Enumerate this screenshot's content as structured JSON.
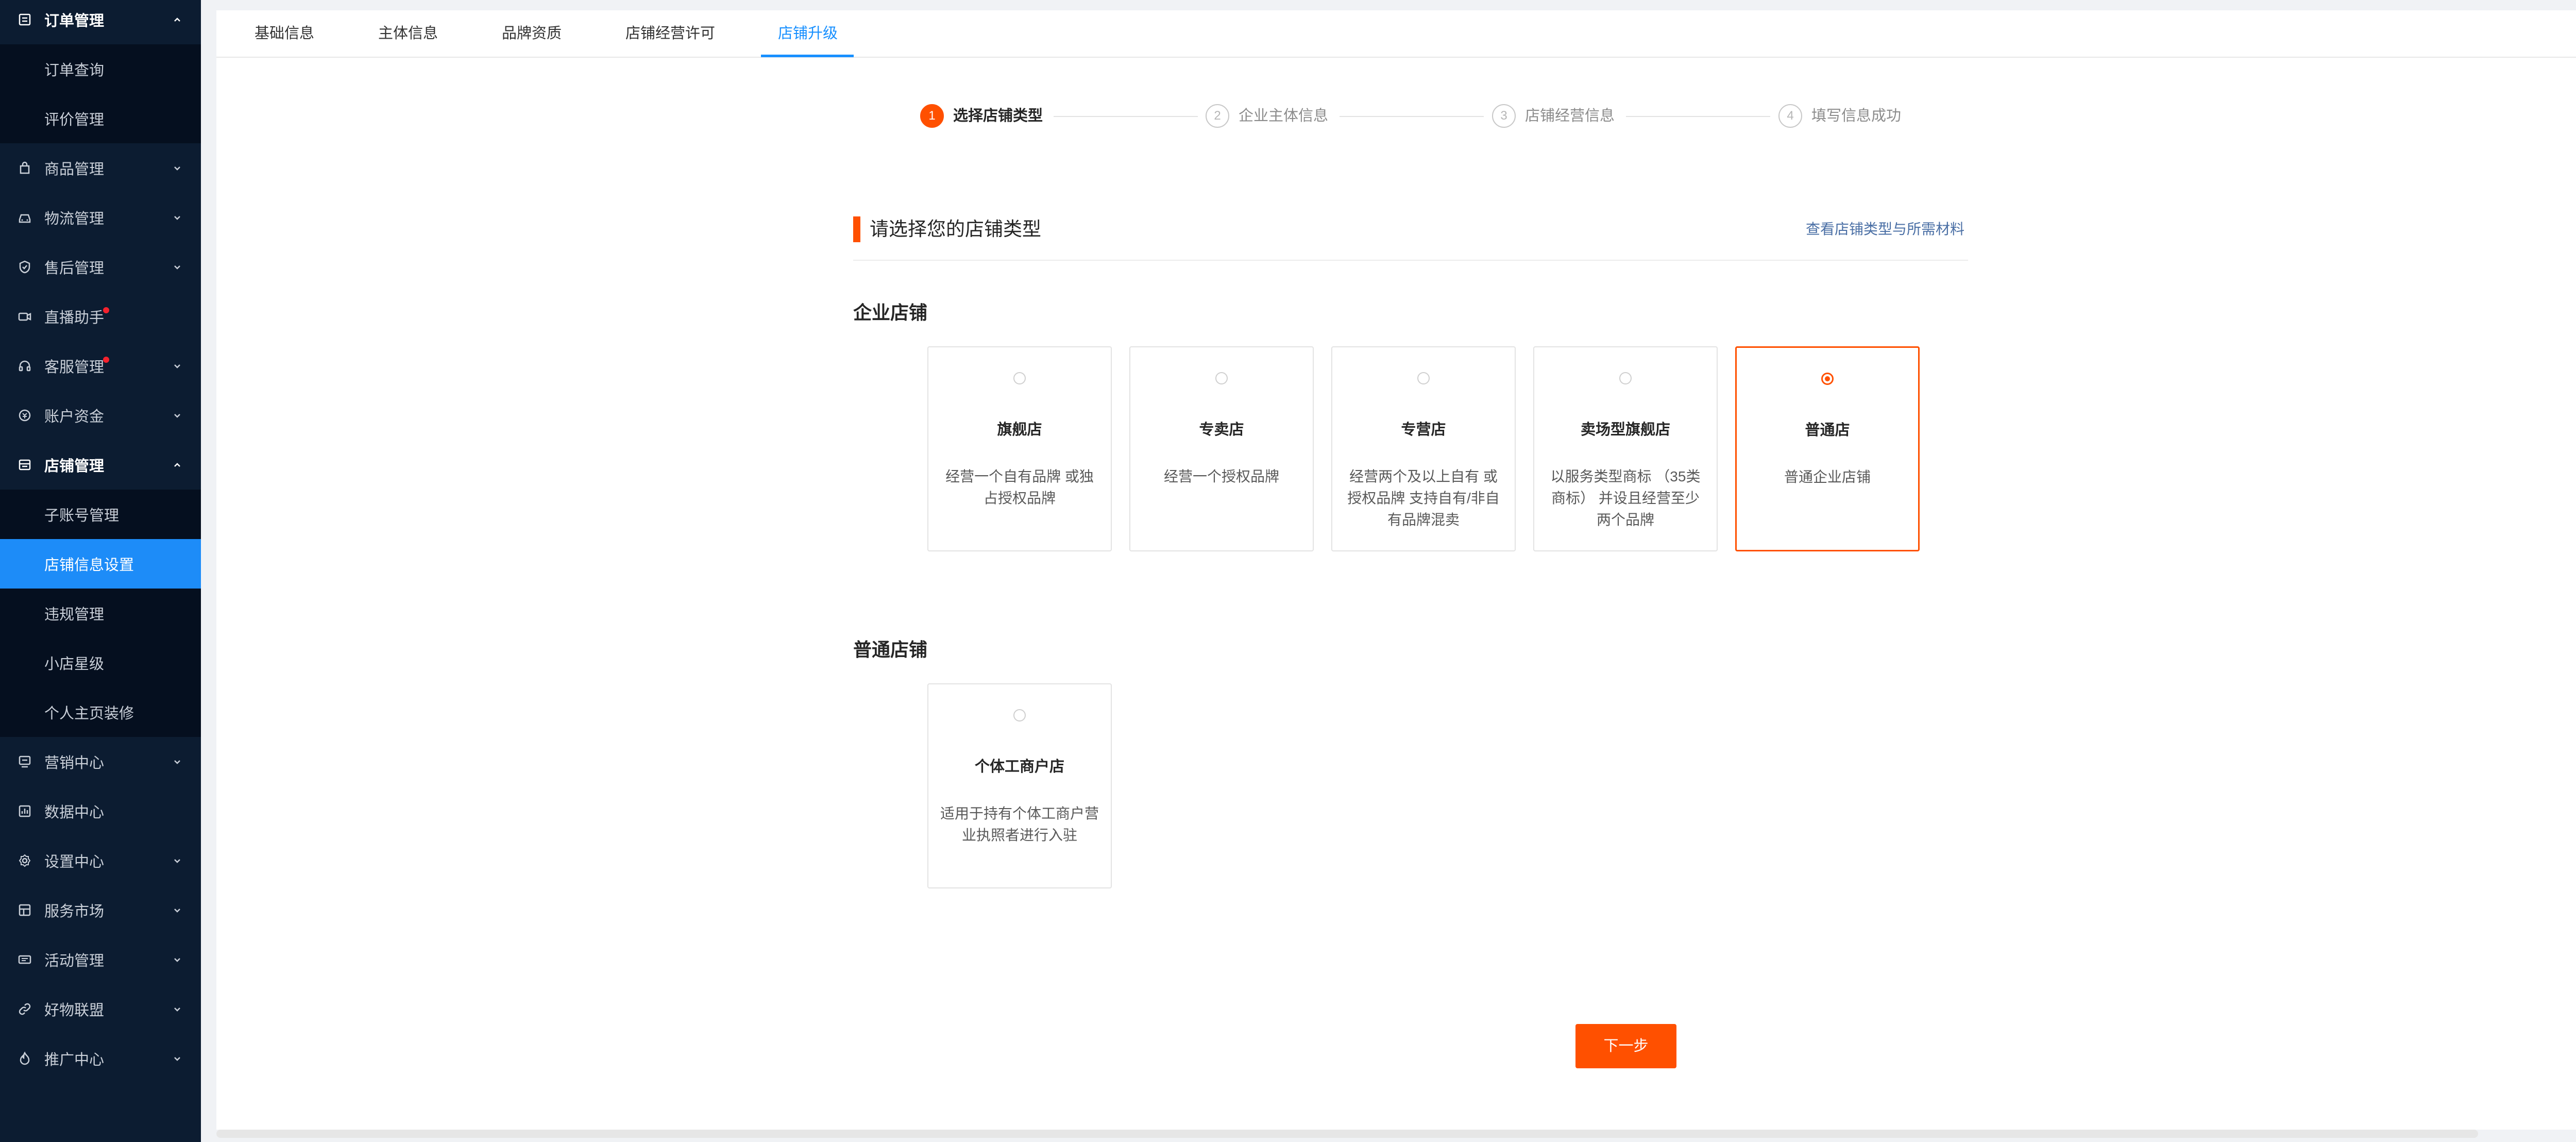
{
  "sidebar": {
    "order": {
      "label": "订单管理",
      "children": [
        "订单查询",
        "评价管理"
      ]
    },
    "goods": {
      "label": "商品管理"
    },
    "logistics": {
      "label": "物流管理"
    },
    "aftersale": {
      "label": "售后管理"
    },
    "live": {
      "label": "直播助手"
    },
    "service": {
      "label": "客服管理"
    },
    "funds": {
      "label": "账户资金"
    },
    "shop": {
      "label": "店铺管理",
      "children": [
        "子账号管理",
        "店铺信息设置",
        "违规管理",
        "小店星级",
        "个人主页装修"
      ]
    },
    "marketing": {
      "label": "营销中心"
    },
    "data": {
      "label": "数据中心"
    },
    "settings": {
      "label": "设置中心"
    },
    "market": {
      "label": "服务市场"
    },
    "activity": {
      "label": "活动管理"
    },
    "alliance": {
      "label": "好物联盟"
    },
    "promotion": {
      "label": "推广中心"
    },
    "active_item": "店铺信息设置"
  },
  "tabs": [
    "基础信息",
    "主体信息",
    "品牌资质",
    "店铺经营许可",
    "店铺升级"
  ],
  "active_tab": "店铺升级",
  "steps": [
    {
      "num": "1",
      "label": "选择店铺类型"
    },
    {
      "num": "2",
      "label": "企业主体信息"
    },
    {
      "num": "3",
      "label": "店铺经营信息"
    },
    {
      "num": "4",
      "label": "填写信息成功"
    }
  ],
  "section_title": "请选择您的店铺类型",
  "materials_link": "查看店铺类型与所需材料",
  "enterprise": {
    "title": "企业店铺",
    "cards": [
      {
        "name": "旗舰店",
        "desc": "经营一个自有品牌 或独占授权品牌"
      },
      {
        "name": "专卖店",
        "desc": "经营一个授权品牌"
      },
      {
        "name": "专营店",
        "desc": "经营两个及以上自有 或授权品牌 支持自有/非自有品牌混卖"
      },
      {
        "name": "卖场型旗舰店",
        "desc": "以服务类型商标 （35类商标） 并设且经营至少两个品牌"
      },
      {
        "name": "普通店",
        "desc": "普通企业店铺"
      }
    ]
  },
  "normal": {
    "title": "普通店铺",
    "cards": [
      {
        "name": "个体工商户店",
        "desc": "适用于持有个体工商户营业执照者进行入驻"
      }
    ]
  },
  "selected_card": "普通店",
  "next_button": "下一步",
  "colors": {
    "accent": "#ff5000",
    "sidebar_bg": "#0c1c31",
    "active_blue": "#1d8cf8",
    "tab_blue": "#1890ff"
  }
}
